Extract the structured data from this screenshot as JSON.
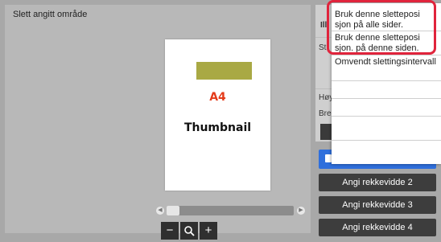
{
  "title": "Slett angitt område",
  "thumbnail": {
    "paper": "A4",
    "caption": "Thumbnail"
  },
  "zoom": {
    "minus": "−",
    "search": "🔍",
    "plus": "+"
  },
  "right_panel": {
    "label_partial_1": "Ill",
    "label_partial_2": "St",
    "label_hoyde": "Høy",
    "label_bredde": "Bred",
    "range_buttons": [
      "Angi rekkevidde 2",
      "Angi rekkevidde 3",
      "Angi rekkevidde 4"
    ]
  },
  "dropdown": {
    "item1": "Bruk denne sletteposi sjon på alle sider.",
    "item2": "Bruk denne sletteposi sjon. på denne siden.",
    "item3": "Omvendt slettingsintervall"
  }
}
